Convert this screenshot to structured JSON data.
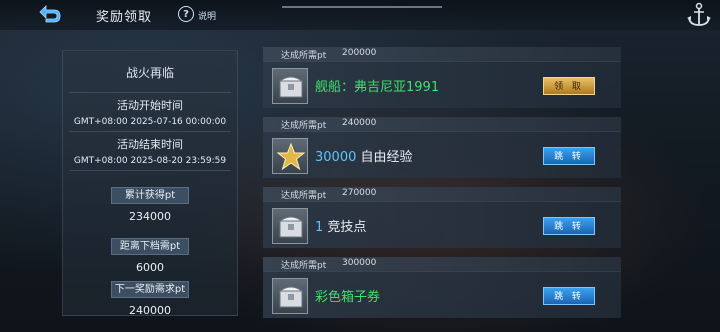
{
  "header": {
    "title": "奖励领取",
    "help_label": "说明",
    "help_glyph": "?"
  },
  "left_panel": {
    "event_title": "战火再临",
    "start_label": "活动开始时间",
    "start_value": "GMT+08:00 2025-07-16 00:00:00",
    "end_label": "活动结束时间",
    "end_value": "GMT+08:00 2025-08-20 23:59:59",
    "accumulated_label": "累计获得pt",
    "accumulated_value": "234000",
    "next_tier_label": "距离下档需pt",
    "next_tier_value": "6000",
    "next_reward_label": "下一奖励需求pt",
    "next_reward_value": "240000"
  },
  "rewards": [
    {
      "req_label": "达成所需pt",
      "req_value": "200000",
      "prefix": "",
      "name": "舰船：弗吉尼亚1991",
      "name_color": "green",
      "icon": "chest-icon",
      "button": "领 取",
      "button_style": "gold"
    },
    {
      "req_label": "达成所需pt",
      "req_value": "240000",
      "prefix": "30000",
      "name": "自由经验",
      "name_color": "white",
      "icon": "star-icon",
      "button": "跳 转",
      "button_style": "blue"
    },
    {
      "req_label": "达成所需pt",
      "req_value": "270000",
      "prefix": "1",
      "name": "竞技点",
      "name_color": "white",
      "icon": "chest-icon",
      "button": "跳 转",
      "button_style": "blue"
    },
    {
      "req_label": "达成所需pt",
      "req_value": "300000",
      "prefix": "",
      "name": "彩色箱子券",
      "name_color": "green",
      "icon": "chest-icon",
      "button": "跳 转",
      "button_style": "blue"
    }
  ],
  "colors": {
    "green": "#3fe06a",
    "blue": "#5ec4ff",
    "gold": "#d9a640",
    "button_blue": "#2a86d6"
  }
}
